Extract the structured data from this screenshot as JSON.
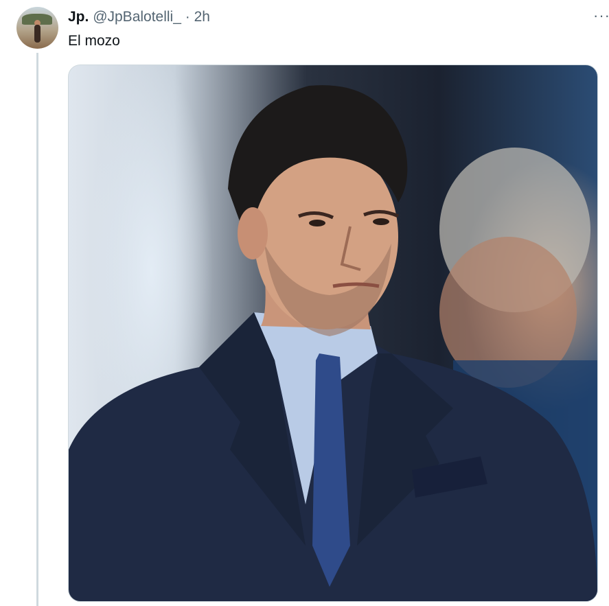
{
  "tweet": {
    "display_name": "Jp.",
    "handle": "@JpBalotelli_",
    "separator": "·",
    "time": "2h",
    "text": "El mozo",
    "more_label": "···"
  },
  "icons": {
    "more": "more-horizontal-icon"
  },
  "colors": {
    "secondary_text": "#536471",
    "primary_text": "#0f1419",
    "thread_line": "#cfd9de"
  }
}
